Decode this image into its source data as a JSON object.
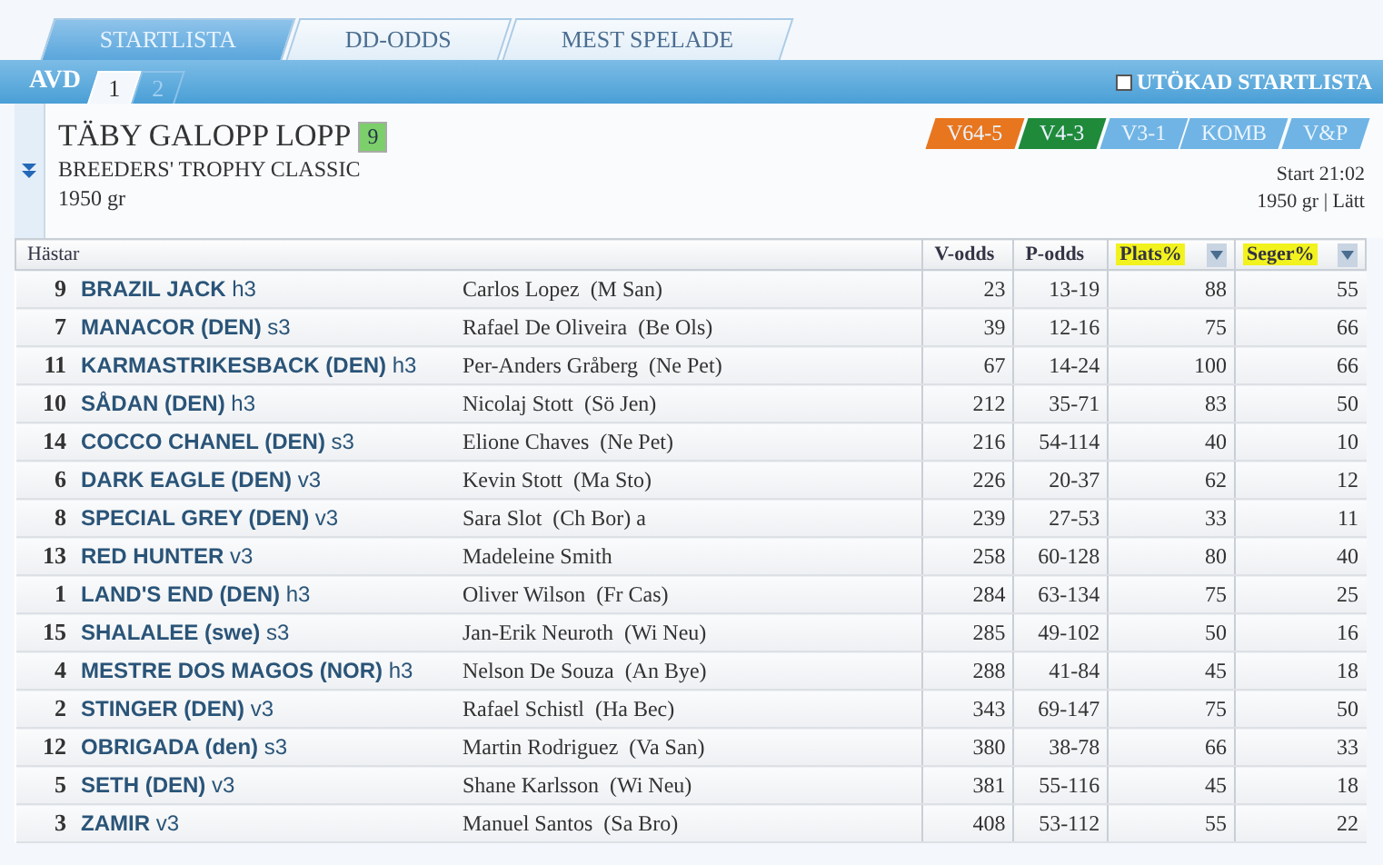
{
  "tabs": [
    {
      "label": "STARTLISTA",
      "selected": true
    },
    {
      "label": "DD-ODDS",
      "selected": false
    },
    {
      "label": "MEST SPELADE",
      "selected": false
    }
  ],
  "division_bar": {
    "label": "AVD",
    "tabs": [
      {
        "label": "1",
        "selected": true
      },
      {
        "label": "2",
        "selected": false
      }
    ],
    "extended_startlist": {
      "label": "UTÖKAD STARTLISTA",
      "checked": false
    }
  },
  "race": {
    "title": "TÄBY GALOPP LOPP",
    "number": "9",
    "subtitle": "BREEDERS' TROPHY CLASSIC",
    "distance": "1950 gr",
    "start": "Start 21:02",
    "conditions": "1950 gr | Lätt",
    "games": [
      {
        "label": "V64-5",
        "color": "#e8761e"
      },
      {
        "label": "V4-3",
        "color": "#1e8a3a"
      },
      {
        "label": "V3-1",
        "color": "#6fb4e4"
      },
      {
        "label": "KOMB",
        "color": "#6fb4e4"
      },
      {
        "label": "V&P",
        "color": "#6fb4e4"
      }
    ]
  },
  "table": {
    "columns": [
      {
        "label": "Hästar",
        "highlighted": false,
        "menu": false
      },
      {
        "label": "V-odds",
        "highlighted": false,
        "menu": false
      },
      {
        "label": "P-odds",
        "highlighted": false,
        "menu": false
      },
      {
        "label": "Plats%",
        "highlighted": true,
        "menu": true
      },
      {
        "label": "Seger%",
        "highlighted": true,
        "menu": true
      }
    ],
    "rows": [
      [
        {
          "number": "9",
          "horse": "**BRAZIL JACK** h3",
          "jockey": "Carlos Lopez  (M San)"
        },
        "23",
        "13-19",
        "88",
        "55"
      ],
      [
        {
          "number": "7",
          "horse": "**MANACOR (DEN)** s3",
          "jockey": "Rafael De Oliveira  (Be Ols)"
        },
        "39",
        "12-16",
        "75",
        "66"
      ],
      [
        {
          "number": "11",
          "horse": "**KARMASTRIKESBACK (DEN)** h3",
          "jockey": "Per-Anders Gråberg  (Ne Pet)"
        },
        "67",
        "14-24",
        "100",
        "66"
      ],
      [
        {
          "number": "10",
          "horse": "**SÅDAN (DEN)** h3",
          "jockey": "Nicolaj Stott  (Sö Jen)"
        },
        "212",
        "35-71",
        "83",
        "50"
      ],
      [
        {
          "number": "14",
          "horse": "**COCCO CHANEL (DEN)** s3",
          "jockey": "Elione Chaves  (Ne Pet)"
        },
        "216",
        "54-114",
        "40",
        "10"
      ],
      [
        {
          "number": "6",
          "horse": "**DARK EAGLE (DEN)** v3",
          "jockey": "Kevin Stott  (Ma Sto)"
        },
        "226",
        "20-37",
        "62",
        "12"
      ],
      [
        {
          "number": "8",
          "horse": "**SPECIAL GREY (DEN)** v3",
          "jockey": "Sara Slot  (Ch Bor) a"
        },
        "239",
        "27-53",
        "33",
        "11"
      ],
      [
        {
          "number": "13",
          "horse": "**RED HUNTER** v3",
          "jockey": "Madeleine Smith"
        },
        "258",
        "60-128",
        "80",
        "40"
      ],
      [
        {
          "number": "1",
          "horse": "**LAND'S END (DEN)** h3",
          "jockey": "Oliver Wilson  (Fr Cas)"
        },
        "284",
        "63-134",
        "75",
        "25"
      ],
      [
        {
          "number": "15",
          "horse": "**SHALALEE (swe)** s3",
          "jockey": "Jan-Erik Neuroth  (Wi Neu)"
        },
        "285",
        "49-102",
        "50",
        "16"
      ],
      [
        {
          "number": "4",
          "horse": "**MESTRE DOS MAGOS (NOR)** h3",
          "jockey": "Nelson De Souza  (An Bye)"
        },
        "288",
        "41-84",
        "45",
        "18"
      ],
      [
        {
          "number": "2",
          "horse": "**STINGER (DEN)** v3",
          "jockey": "Rafael Schistl  (Ha Bec)"
        },
        "343",
        "69-147",
        "75",
        "50"
      ],
      [
        {
          "number": "12",
          "horse": "**OBRIGADA (den)** s3",
          "jockey": "Martin Rodriguez  (Va San)"
        },
        "380",
        "38-78",
        "66",
        "33"
      ],
      [
        {
          "number": "5",
          "horse": "**SETH (DEN)** v3",
          "jockey": "Shane Karlsson  (Wi Neu)"
        },
        "381",
        "55-116",
        "45",
        "18"
      ],
      [
        {
          "number": "3",
          "horse": "**ZAMIR** v3",
          "jockey": "Manuel Santos  (Sa Bro)"
        },
        "408",
        "53-112",
        "55",
        "22"
      ]
    ]
  }
}
